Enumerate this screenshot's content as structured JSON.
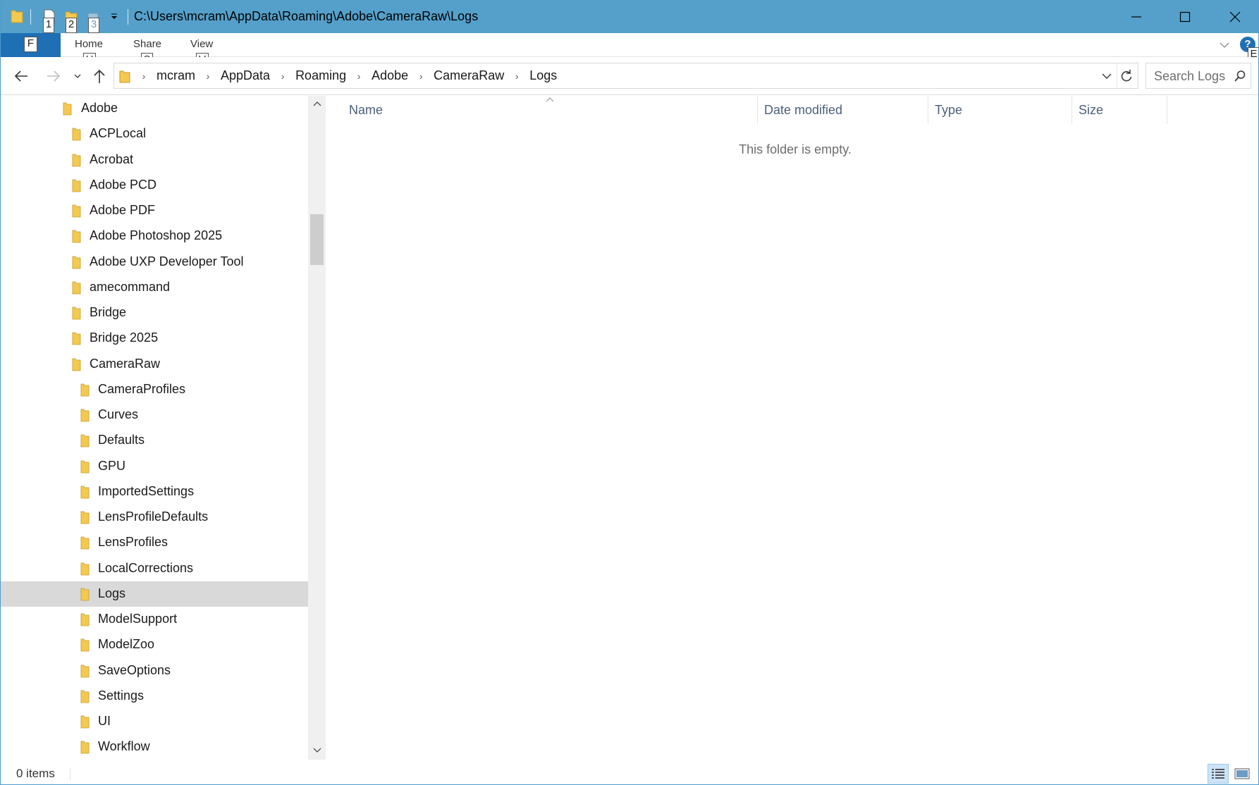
{
  "window": {
    "title_path": "C:\\Users\\mcram\\AppData\\Roaming\\Adobe\\CameraRaw\\Logs",
    "qat_keytips": [
      "1",
      "2",
      "3"
    ],
    "title_bg": "#55a0cb"
  },
  "ribbon": {
    "file_keytip": "F",
    "tabs": [
      {
        "label": "Home",
        "keytip": "H"
      },
      {
        "label": "Share",
        "keytip": "S"
      },
      {
        "label": "View",
        "keytip": "V"
      }
    ],
    "help_keytip": "E"
  },
  "address": {
    "crumbs": [
      "mcram",
      "AppData",
      "Roaming",
      "Adobe",
      "CameraRaw",
      "Logs"
    ],
    "search_placeholder": "Search Logs"
  },
  "navpane": {
    "items": [
      {
        "label": "Adobe",
        "level": 0,
        "selected": false
      },
      {
        "label": "ACPLocal",
        "level": 1,
        "selected": false
      },
      {
        "label": "Acrobat",
        "level": 1,
        "selected": false
      },
      {
        "label": "Adobe PCD",
        "level": 1,
        "selected": false
      },
      {
        "label": "Adobe PDF",
        "level": 1,
        "selected": false
      },
      {
        "label": "Adobe Photoshop 2025",
        "level": 1,
        "selected": false
      },
      {
        "label": "Adobe UXP Developer Tool",
        "level": 1,
        "selected": false
      },
      {
        "label": "amecommand",
        "level": 1,
        "selected": false
      },
      {
        "label": "Bridge",
        "level": 1,
        "selected": false
      },
      {
        "label": "Bridge 2025",
        "level": 1,
        "selected": false
      },
      {
        "label": "CameraRaw",
        "level": 1,
        "selected": false
      },
      {
        "label": "CameraProfiles",
        "level": 2,
        "selected": false
      },
      {
        "label": "Curves",
        "level": 2,
        "selected": false
      },
      {
        "label": "Defaults",
        "level": 2,
        "selected": false
      },
      {
        "label": "GPU",
        "level": 2,
        "selected": false
      },
      {
        "label": "ImportedSettings",
        "level": 2,
        "selected": false
      },
      {
        "label": "LensProfileDefaults",
        "level": 2,
        "selected": false
      },
      {
        "label": "LensProfiles",
        "level": 2,
        "selected": false
      },
      {
        "label": "LocalCorrections",
        "level": 2,
        "selected": false
      },
      {
        "label": "Logs",
        "level": 2,
        "selected": true
      },
      {
        "label": "ModelSupport",
        "level": 2,
        "selected": false
      },
      {
        "label": "ModelZoo",
        "level": 2,
        "selected": false
      },
      {
        "label": "SaveOptions",
        "level": 2,
        "selected": false
      },
      {
        "label": "Settings",
        "level": 2,
        "selected": false
      },
      {
        "label": "UI",
        "level": 2,
        "selected": false
      },
      {
        "label": "Workflow",
        "level": 2,
        "selected": false
      }
    ]
  },
  "content": {
    "columns": [
      "Name",
      "Date modified",
      "Type",
      "Size"
    ],
    "empty_message": "This folder is empty."
  },
  "status": {
    "item_count": "0 items"
  },
  "colors": {
    "folder": "#f3c94f",
    "selection": "#d9d9d9",
    "header_text": "#4c607a"
  }
}
